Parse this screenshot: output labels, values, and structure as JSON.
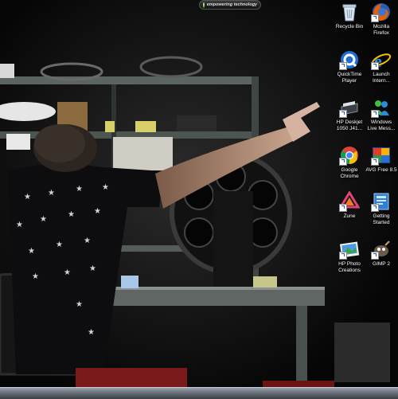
{
  "gadget": {
    "text": "empowering technology"
  },
  "desktop_icons": [
    {
      "label": "Recycle Bin",
      "icon": "recycle-bin-icon"
    },
    {
      "label": "Mozilla\nFirefox",
      "icon": "firefox-icon"
    },
    {
      "label": "QuickTime\nPlayer",
      "icon": "quicktime-icon"
    },
    {
      "label": "Launch\nIntern...",
      "icon": "internet-explorer-icon"
    },
    {
      "label": "HP Deskjet\n1050 J41...",
      "icon": "printer-icon"
    },
    {
      "label": "Windows\nLive Mess...",
      "icon": "messenger-icon"
    },
    {
      "label": "Google\nChrome",
      "icon": "chrome-icon"
    },
    {
      "label": "AVG Free 8.5",
      "icon": "avg-icon"
    },
    {
      "label": "Zune",
      "icon": "zune-icon"
    },
    {
      "label": "Getting\nStarted",
      "icon": "getting-started-icon"
    },
    {
      "label": "HP Photo\nCreations",
      "icon": "photo-icon"
    },
    {
      "label": "GIMP 2",
      "icon": "gimp-icon"
    }
  ],
  "colors": {
    "accent_blue": "#1a5fc9",
    "firefox_orange": "#e66000",
    "chrome_red": "#db4437",
    "chrome_yellow": "#f4c20d",
    "chrome_green": "#0f9d58"
  }
}
